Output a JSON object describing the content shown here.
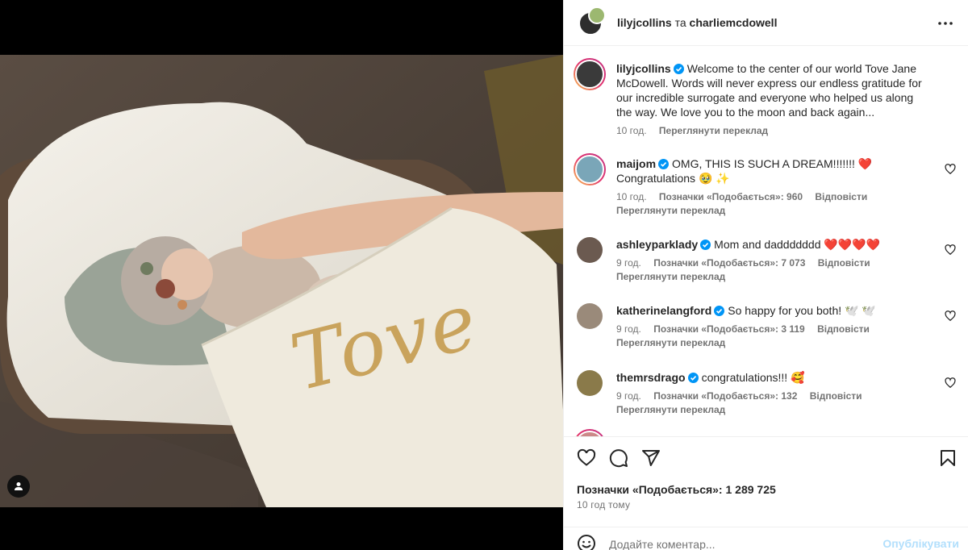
{
  "post": {
    "header_user1": "lilyjcollins",
    "header_and": "та",
    "header_user2": "charliemcdowell",
    "caption_user": "lilyjcollins",
    "caption_text": "Welcome to the center of our world Tove Jane McDowell. Words will never express our endless gratitude for our incredible surrogate and everyone who helped us along the way. We love you to the moon and back again...",
    "caption_time": "10 год.",
    "translate_label": "Переглянути переклад",
    "likes_label": "Позначки «Подобається»: 1 289 725",
    "posted_ago": "10 год тому",
    "image_text": "Tove"
  },
  "comments": [
    {
      "user": "maijom",
      "text": "OMG, THIS IS SUCH A DREAM!!!!!!! ❤️ Congratulations 🥹 ✨",
      "time": "10 год.",
      "likes": "Позначки «Подобається»: 960",
      "reply": "Відповісти",
      "translate": "Переглянути переклад"
    },
    {
      "user": "ashleyparklady",
      "text": "Mom and daddddddd ❤️❤️❤️❤️",
      "time": "9 год.",
      "likes": "Позначки «Подобається»: 7 073",
      "reply": "Відповісти",
      "translate": "Переглянути переклад"
    },
    {
      "user": "katherinelangford",
      "text": "So happy for you both! 🕊️ 🕊️",
      "time": "9 год.",
      "likes": "Позначки «Подобається»: 3 119",
      "reply": "Відповісти",
      "translate": "Переглянути переклад"
    },
    {
      "user": "themrsdrago",
      "text": "congratulations!!! 🥰",
      "time": "9 год.",
      "likes": "Позначки «Подобається»: 132",
      "reply": "Відповісти",
      "translate": "Переглянути переклад"
    }
  ],
  "composer": {
    "placeholder": "Додайте коментар...",
    "post_label": "Опублікувати"
  },
  "icons": {
    "verified": "verified-badge-icon",
    "more": "more-options-icon",
    "like": "heart-icon",
    "comment": "comment-icon",
    "share": "share-icon",
    "save": "bookmark-icon",
    "emoji": "emoji-icon",
    "tag": "user-tag-icon"
  },
  "colors": {
    "verified": "#0095f6",
    "text": "#262626",
    "secondary": "#737373",
    "post_button_disabled": "#b2dffc"
  }
}
